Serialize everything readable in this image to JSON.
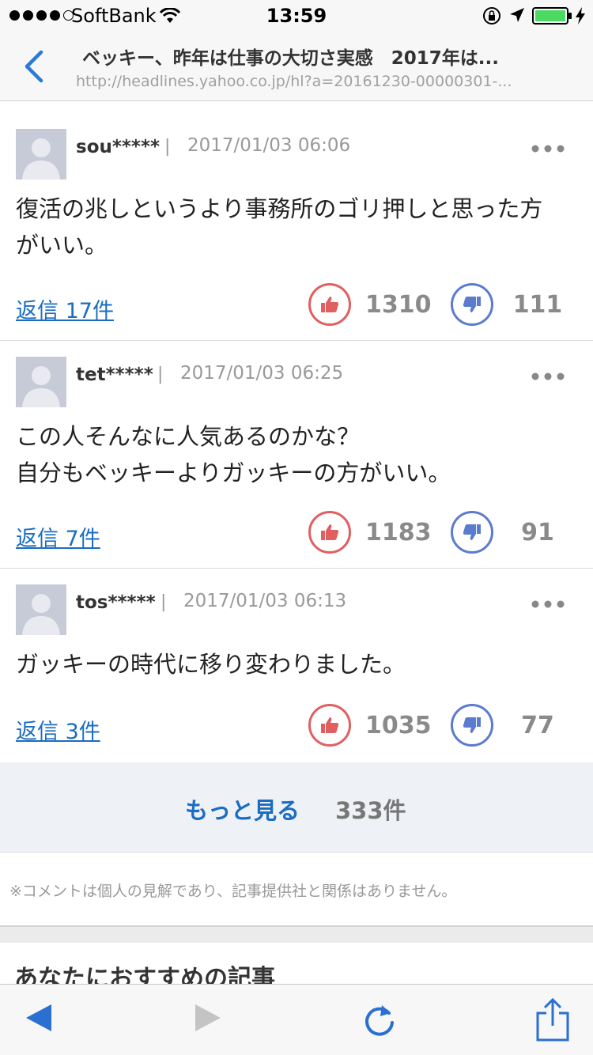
{
  "status_bar": {
    "carrier": "SoftBank",
    "time": "13:59",
    "signal_icon": "signal-dots-icon",
    "wifi_icon": "wifi-icon",
    "battery_color": "#4cd964"
  },
  "header": {
    "title": "ベッキー、昨年は仕事の大切さ実感　2017年は...",
    "url": "http://headlines.yahoo.co.jp/hl?a=20161230-00000301-...",
    "back_icon": "chevron-left-icon"
  },
  "comments": [
    {
      "user": "sou*****",
      "separator": "|",
      "date": "2017/01/03 06:06",
      "text_lines": [
        "復活の兆しというより事務所のゴリ押しと思った方",
        "がいい。"
      ],
      "reply": "返信 17件",
      "likes": "1310",
      "dislikes": "111"
    },
    {
      "user": "tet*****",
      "separator": "|",
      "date": "2017/01/03 06:25",
      "text_lines": [
        "この人そんなに人気あるのかな？",
        "自分もベッキーよりガッキーの方がいい。"
      ],
      "reply": "返信 7件",
      "likes": "1183",
      "dislikes": "91"
    },
    {
      "user": "tos*****",
      "separator": "|",
      "date": "2017/01/03 06:13",
      "text_lines": [
        "ガッキーの時代に移り変わりました。"
      ],
      "reply": "返信 3件",
      "likes": "1035",
      "dislikes": "77"
    }
  ],
  "more": {
    "label": "もっと見る",
    "count": "333件"
  },
  "disclaimer": "※コメントは個人の見解であり、記事提供社と関係はありません。",
  "recommended_title": "あなたにおすすめの記事",
  "colors": {
    "accent": "#1a6dc1",
    "like": "#e15f5f",
    "dislike": "#5b7bcf"
  }
}
